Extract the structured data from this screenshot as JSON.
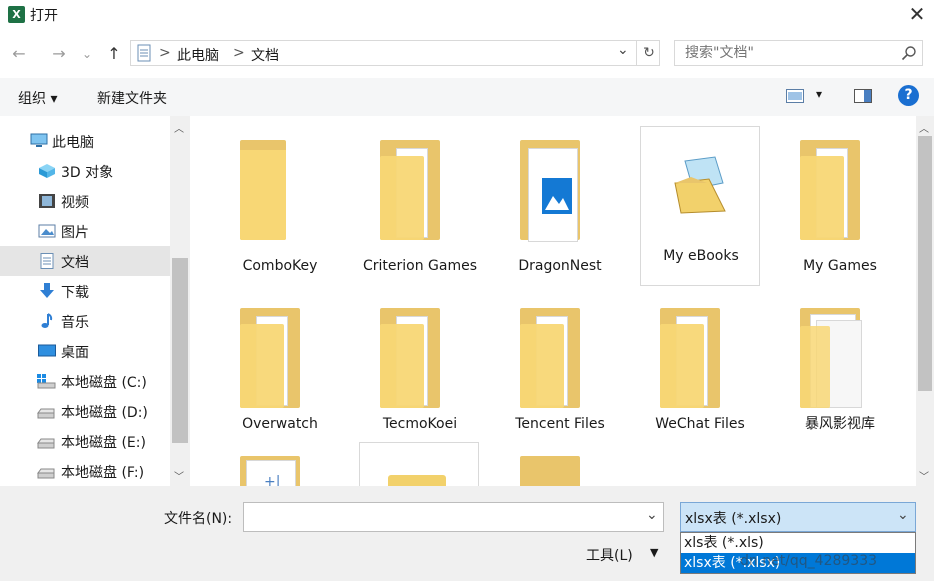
{
  "window": {
    "title": "打开",
    "app_icon_letter": "X",
    "close_label": "✕"
  },
  "nav": {
    "back": "←",
    "forward": "→",
    "recent": "⌄",
    "up": "↑"
  },
  "address": {
    "sep": ">",
    "segments": [
      "此电脑",
      "文档"
    ],
    "dropdown": "⌄",
    "refresh": "↻"
  },
  "search": {
    "placeholder": "搜索\"文档\""
  },
  "toolbar": {
    "organize": "组织 ▾",
    "new_folder": "新建文件夹",
    "view_arrow": "▾",
    "help": "?"
  },
  "sidebar": {
    "root": "此电脑",
    "items": [
      "3D 对象",
      "视频",
      "图片",
      "文档",
      "下载",
      "音乐",
      "桌面",
      "本地磁盘 (C:)",
      "本地磁盘 (D:)",
      "本地磁盘 (E:)",
      "本地磁盘 (F:)"
    ],
    "selected": "文档"
  },
  "files": [
    "ComboKey",
    "Criterion Games",
    "DragonNest",
    "My eBooks",
    "My Games",
    "Overwatch",
    "TecmoKoei",
    "Tencent Files",
    "WeChat Files",
    "暴风影视库"
  ],
  "bottom": {
    "filename_label": "文件名(N):",
    "filename_value": "",
    "filetype_selected": "xlsx表 (*.xlsx)",
    "filetype_options": [
      "xls表 (*.xls)",
      "xlsx表 (*.xlsx)"
    ],
    "tools_label": "工具(L)",
    "watermark": "dn.net/qq_4289333"
  },
  "colors": {
    "folder_front": "#f8d775",
    "folder_back": "#e9c56b",
    "selection": "#0078d7",
    "help": "#1a6fd1"
  }
}
